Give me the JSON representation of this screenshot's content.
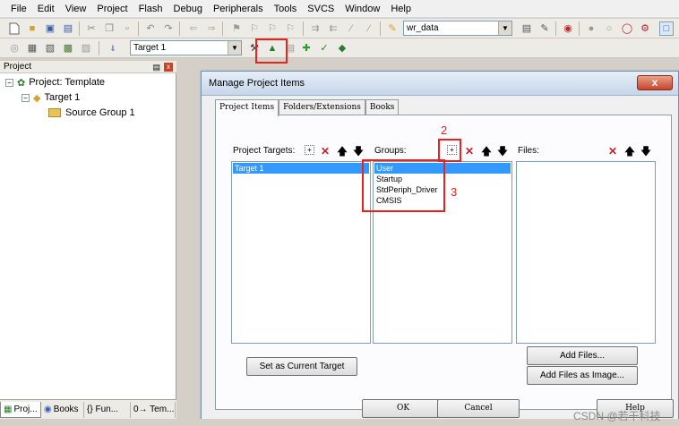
{
  "menubar": {
    "items": [
      "File",
      "Edit",
      "View",
      "Project",
      "Flash",
      "Debug",
      "Peripherals",
      "Tools",
      "SVCS",
      "Window",
      "Help"
    ]
  },
  "toolbar1": {
    "combo_value": "wr_data"
  },
  "toolbar2": {
    "target_combo": "Target 1"
  },
  "project_panel": {
    "title": "Project",
    "tree": {
      "root": "Project: Template",
      "target": "Target 1",
      "group": "Source Group 1"
    },
    "tabs": [
      "Proj...",
      "Books",
      "{} Fun...",
      "0→ Tem..."
    ]
  },
  "dialog": {
    "title": "Manage Project Items",
    "close_label": "x",
    "tabs": [
      "Project Items",
      "Folders/Extensions",
      "Books"
    ],
    "targets": {
      "header": "Project Targets:",
      "items": [
        "Target 1"
      ],
      "selected": 0
    },
    "groups": {
      "header": "Groups:",
      "items": [
        "User",
        "Startup",
        "StdPeriph_Driver",
        "CMSIS"
      ],
      "selected": 0
    },
    "files": {
      "header": "Files:",
      "items": []
    },
    "buttons": {
      "set_target": "Set as Current Target",
      "add_files": "Add Files...",
      "add_files_image": "Add Files as Image...",
      "ok": "OK",
      "cancel": "Cancel",
      "help": "Help"
    }
  },
  "annotations": {
    "label_2": "2",
    "label_3": "3",
    "color": "#e8231f"
  },
  "watermark": "CSDN @若干科技",
  "colors": {
    "selection": "#3399ff",
    "title_bar": "#c6d6ea",
    "annotation": "#e8231f"
  }
}
